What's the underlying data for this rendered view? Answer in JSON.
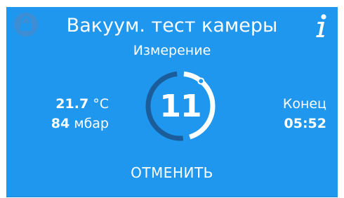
{
  "header": {
    "title": "Вакуум. тест камеры",
    "subtitle": "Измерение",
    "lock_icon": "lock-icon",
    "info_icon": "info-icon"
  },
  "readings": {
    "temperature_value": "21.7",
    "temperature_unit": "°C",
    "pressure_value": "84",
    "pressure_unit": "мбар"
  },
  "timer": {
    "countdown": "11",
    "progress_fraction": 0.47
  },
  "end": {
    "label": "Конец",
    "time": "05:52"
  },
  "actions": {
    "cancel_label": "ОТМЕНИТЬ"
  },
  "colors": {
    "background": "#1f97ee",
    "ring_remaining": "#1a5d9a",
    "ring_progress": "#ffffff",
    "lock_bg": "#3d8ed4"
  }
}
